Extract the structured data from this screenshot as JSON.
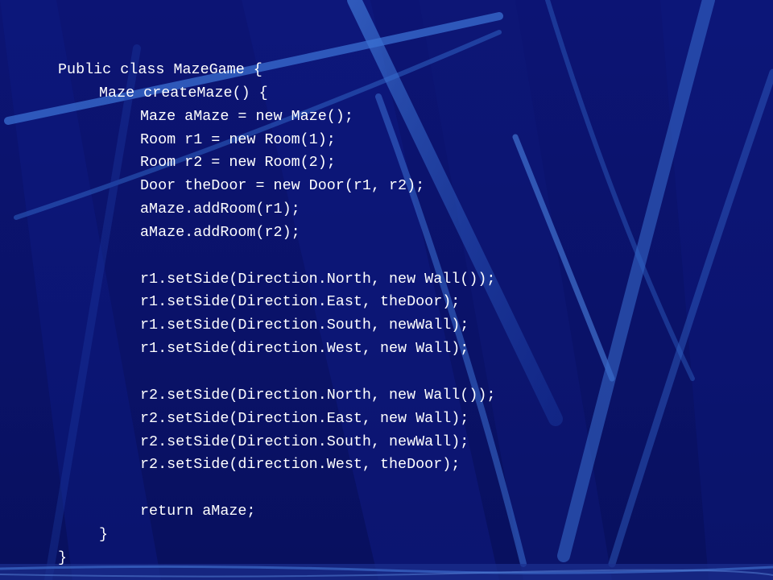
{
  "slide": {
    "code_lines": [
      "Public class MazeGame {",
      "Maze createMaze() {",
      "Maze aMaze = new Maze();",
      "Room r1 = new Room(1);",
      "Room r2 = new Room(2);",
      "Door theDoor = new Door(r1, r2);",
      "aMaze.addRoom(r1);",
      "aMaze.addRoom(r2);",
      "r1.setSide(Direction.North, new Wall());",
      "r1.setSide(Direction.East, theDoor);",
      "r1.setSide(Direction.South, newWall);",
      "r1.setSide(direction.West, new Wall);",
      "r2.setSide(Direction.North, new Wall());",
      "r2.setSide(Direction.East, new Wall);",
      "r2.setSide(Direction.South, newWall);",
      "r2.setSide(direction.West, theDoor);",
      "return aMaze;",
      "}",
      "}"
    ]
  },
  "colors": {
    "background": "#0b1370",
    "text": "#ffffff",
    "stripe": "#2f63c4"
  }
}
